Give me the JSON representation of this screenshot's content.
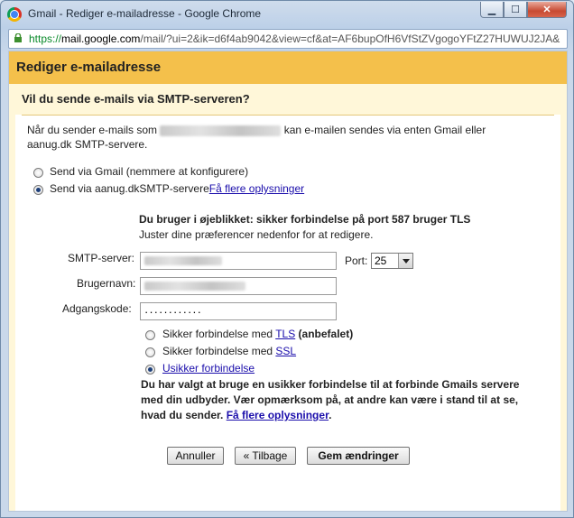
{
  "window": {
    "title": "Gmail - Rediger e-mailadresse - Google Chrome",
    "minimize_glyph": "▁",
    "maximize_glyph": "☐",
    "close_glyph": "✕"
  },
  "address_bar": {
    "scheme": "https://",
    "host": "mail.google.com",
    "path": "/mail/?ui=2&ik=d6f4ab9042&view=cf&at=AF6bupOfH6VfStZVgogoYFtZ27HUWUJ2JA&"
  },
  "dialog": {
    "title": "Rediger e-mailadresse",
    "question": "Vil du sende e-mails via SMTP-serveren?",
    "intro_part1": "Når du sender e-mails som",
    "intro_part2": "kan e-mailen sendes via enten Gmail eller",
    "intro_line2": "aanug.dk SMTP-servere.",
    "send_options": [
      {
        "label": "Send via Gmail (nemmere at konfigurere)",
        "checked": false
      },
      {
        "label": "Send via aanug.dkSMTP-servere",
        "checked": true
      }
    ],
    "learn_more": "Få flere oplysninger",
    "status_heading": "Du bruger i øjeblikket: sikker forbindelse på port 587 bruger TLS",
    "status_sub": "Juster dine præferencer nedenfor for at redigere.",
    "smtp_label": "SMTP-server:",
    "port_label": "Port:",
    "port_value": "25",
    "username_label": "Brugernavn:",
    "password_label": "Adgangskode:",
    "password_mask": "············",
    "security_options": [
      {
        "prefix": "Sikker forbindelse med ",
        "link": "TLS",
        "suffix": " (anbefalet)",
        "checked": false
      },
      {
        "prefix": "Sikker forbindelse med ",
        "link": "SSL",
        "suffix": "",
        "checked": false
      },
      {
        "prefix": "",
        "link": "Usikker forbindelse",
        "suffix": "",
        "checked": true
      }
    ],
    "warning_text": "Du har valgt at bruge en usikker forbindelse til at forbinde Gmails servere med din udbyder. Vær opmærksom på, at andre kan være i stand til at se, hvad du sender.",
    "warning_link": "Få flere oplysninger",
    "warning_end": ".",
    "buttons": {
      "cancel": "Annuller",
      "back": "« Tilbage",
      "save": "Gem ændringer"
    }
  }
}
